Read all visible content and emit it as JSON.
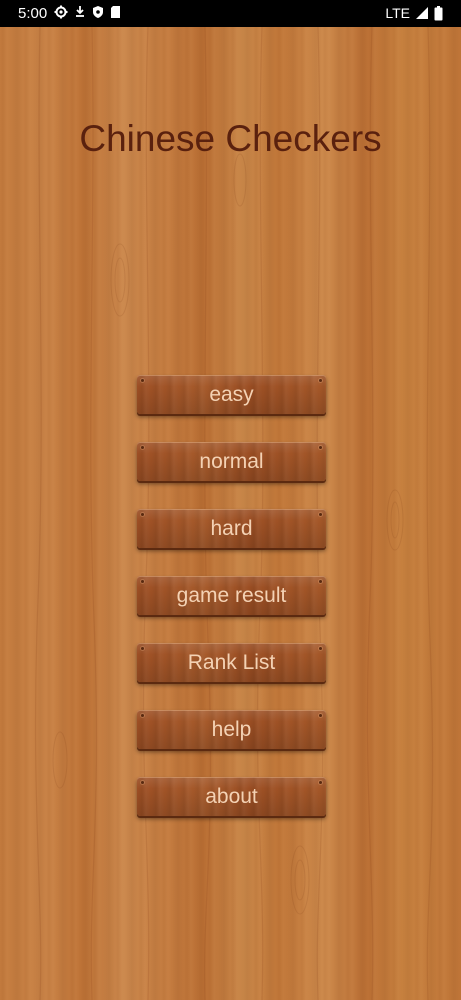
{
  "status_bar": {
    "time": "5:00",
    "network": "LTE",
    "icons_left": [
      "gear-icon",
      "download-icon",
      "shield-icon",
      "sd-card-icon"
    ],
    "icons_right": [
      "signal-icon",
      "battery-icon"
    ]
  },
  "app": {
    "title": "Chinese Checkers"
  },
  "menu": {
    "easy_label": "easy",
    "normal_label": "normal",
    "hard_label": "hard",
    "game_result_label": "game result",
    "rank_list_label": "Rank List",
    "help_label": "help",
    "about_label": "about"
  },
  "colors": {
    "wood_background": "#c27a3d",
    "title_text": "#5a210e",
    "button_wood": "#a0522a",
    "button_text": "#f4d2b4",
    "status_bar": "#000000"
  }
}
